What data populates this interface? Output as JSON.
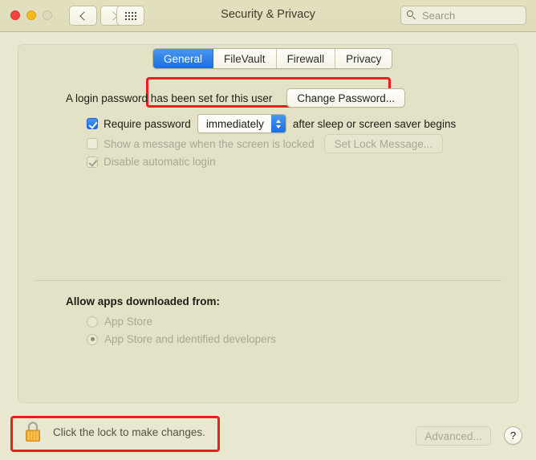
{
  "window": {
    "title": "Security & Privacy",
    "traffic_lights": [
      "close",
      "minimize",
      "zoom"
    ]
  },
  "toolbar": {
    "back_icon": "chevron-left-icon",
    "forward_icon": "chevron-right-icon",
    "grid_icon": "show-all-grid-icon",
    "search": {
      "placeholder": "Search",
      "value": "",
      "icon": "search-icon"
    }
  },
  "tabs": [
    {
      "label": "General",
      "active": true
    },
    {
      "label": "FileVault",
      "active": false
    },
    {
      "label": "Firewall",
      "active": false
    },
    {
      "label": "Privacy",
      "active": false
    }
  ],
  "general": {
    "password_status": "A login password has been set for this user",
    "change_password_label": "Change Password...",
    "require_password": {
      "checked": true,
      "label": "Require password",
      "delay_value": "immediately",
      "suffix": "after sleep or screen saver begins"
    },
    "lock_message": {
      "checked": false,
      "label": "Show a message when the screen is locked",
      "button_label": "Set Lock Message...",
      "enabled": false
    },
    "disable_auto_login": {
      "checked": true,
      "label": "Disable automatic login",
      "enabled": false
    },
    "allow_apps_heading": "Allow apps downloaded from:",
    "allow_apps_options": [
      {
        "label": "App Store",
        "selected": false
      },
      {
        "label": "App Store and identified developers",
        "selected": true
      }
    ]
  },
  "footer": {
    "lock_icon": "padlock-closed-icon",
    "lock_text": "Click the lock to make changes.",
    "advanced_label": "Advanced...",
    "advanced_enabled": false,
    "help_label": "?"
  },
  "annotations": {
    "highlight_color": "#ee1c1c",
    "boxes": [
      "tab-bar",
      "lock-bar"
    ]
  },
  "colors": {
    "accent_blue": "#1a6fe0",
    "window_bg": "#e9e7d0",
    "titlebar_bg": "#dfdcbb",
    "panel_bg": "#e3e2c7",
    "lock_body": "#f0ab2e"
  }
}
